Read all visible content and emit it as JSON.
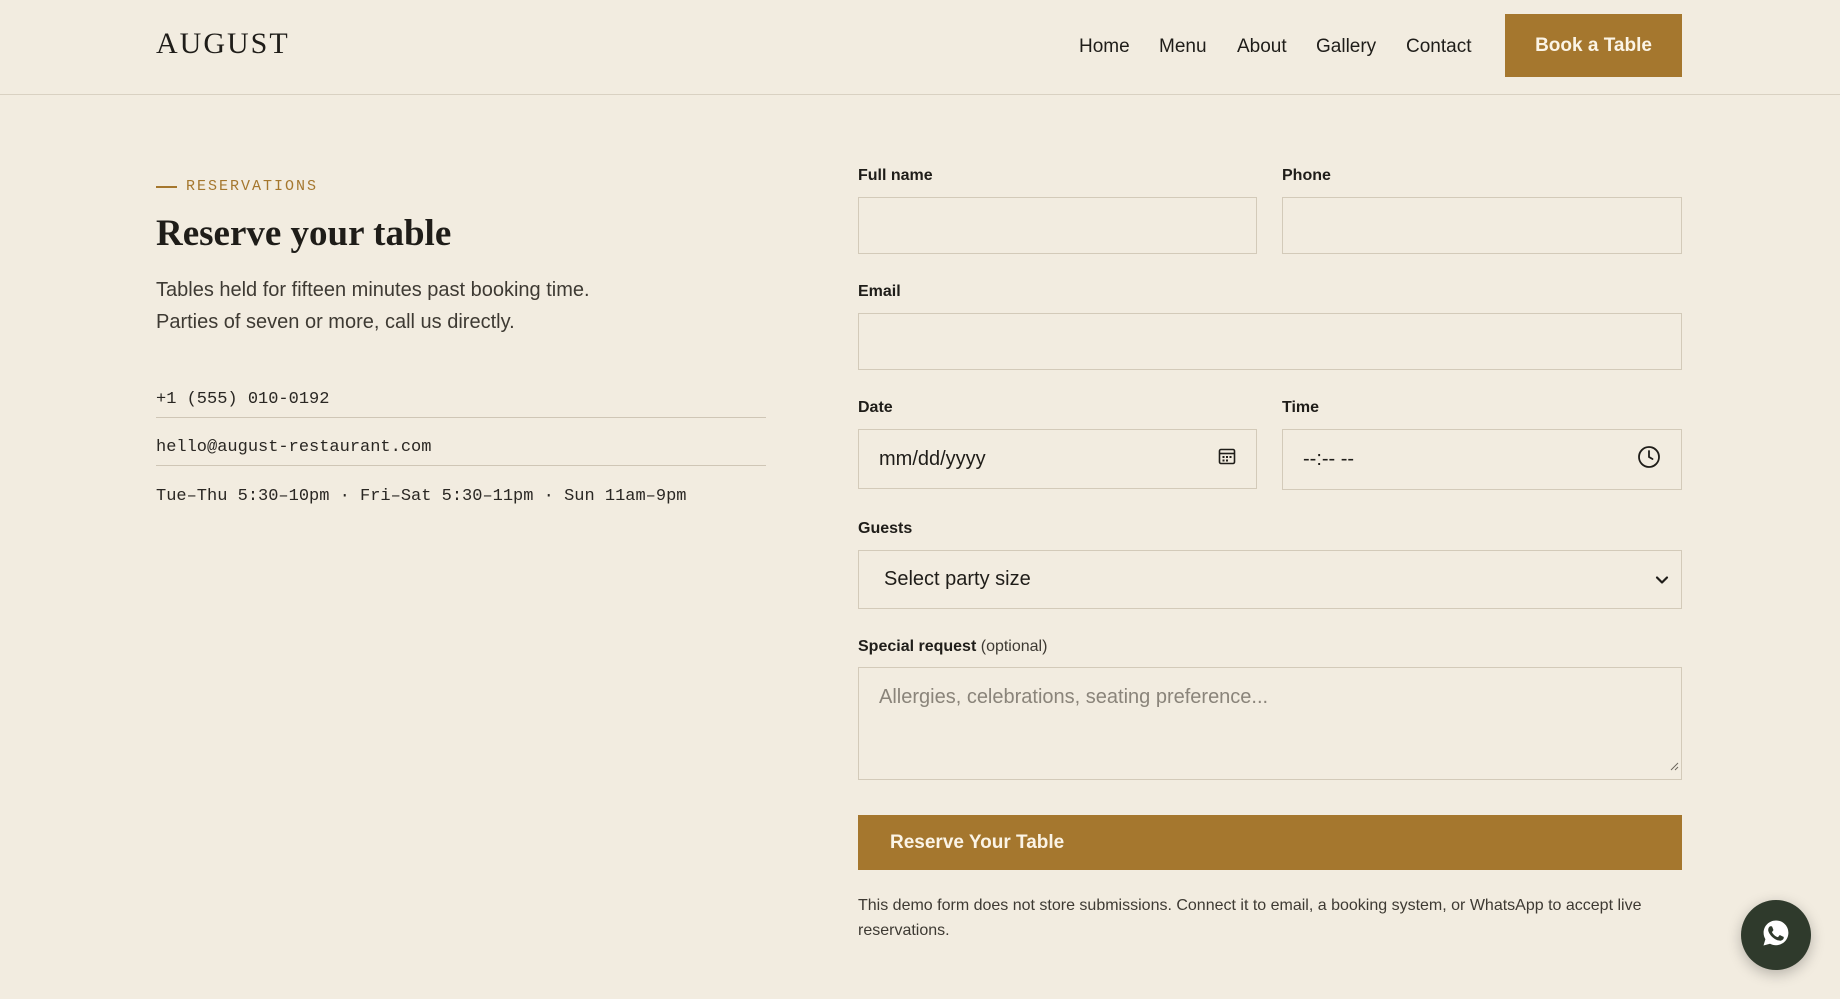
{
  "header": {
    "logo": "AUGUST",
    "nav": [
      "Home",
      "Menu",
      "About",
      "Gallery",
      "Contact"
    ],
    "cta": "Book a Table"
  },
  "intro": {
    "eyebrow": "RESERVATIONS",
    "title": "Reserve your table",
    "description": "Tables held for fifteen minutes past booking time. Parties of seven or more, call us directly.",
    "phone": "+1 (555) 010-0192",
    "email": "hello@august-restaurant.com",
    "hours": "Tue–Thu 5:30–10pm · Fri–Sat 5:30–11pm · Sun 11am–9pm"
  },
  "form": {
    "full_name_label": "Full name",
    "full_name_value": "",
    "phone_label": "Phone",
    "phone_value": "",
    "email_label": "Email",
    "email_value": "",
    "date_label": "Date",
    "date_placeholder": "mm/dd/yyyy",
    "time_label": "Time",
    "time_placeholder": "--:-- --",
    "guests_label": "Guests",
    "guests_selected": "Select party size",
    "request_label": "Special request",
    "request_optional": "(optional)",
    "request_placeholder": "Allergies, celebrations, seating preference...",
    "submit": "Reserve Your Table",
    "note": "This demo form does not store submissions. Connect it to email, a booking system, or WhatsApp to accept live reservations."
  },
  "icons": {
    "date": "calendar-icon",
    "time": "clock-icon",
    "guests": "chevron-down-icon",
    "chat": "whatsapp-icon"
  },
  "colors": {
    "background": "#f2ece0",
    "accent": "#a5772e",
    "chat_button": "#2f3a2c"
  }
}
